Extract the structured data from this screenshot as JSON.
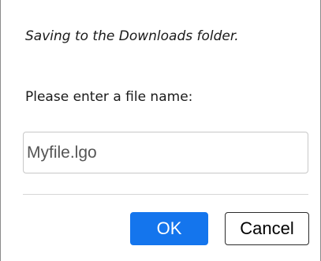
{
  "dialog": {
    "info_text": "Saving to the Downloads folder.",
    "prompt_label": "Please enter a file name:",
    "filename_value": "Myfile.lgo",
    "ok_label": "OK",
    "cancel_label": "Cancel"
  },
  "colors": {
    "primary_button": "#1475ed",
    "input_border": "#c8c8c8",
    "divider": "#d6d6d6"
  }
}
